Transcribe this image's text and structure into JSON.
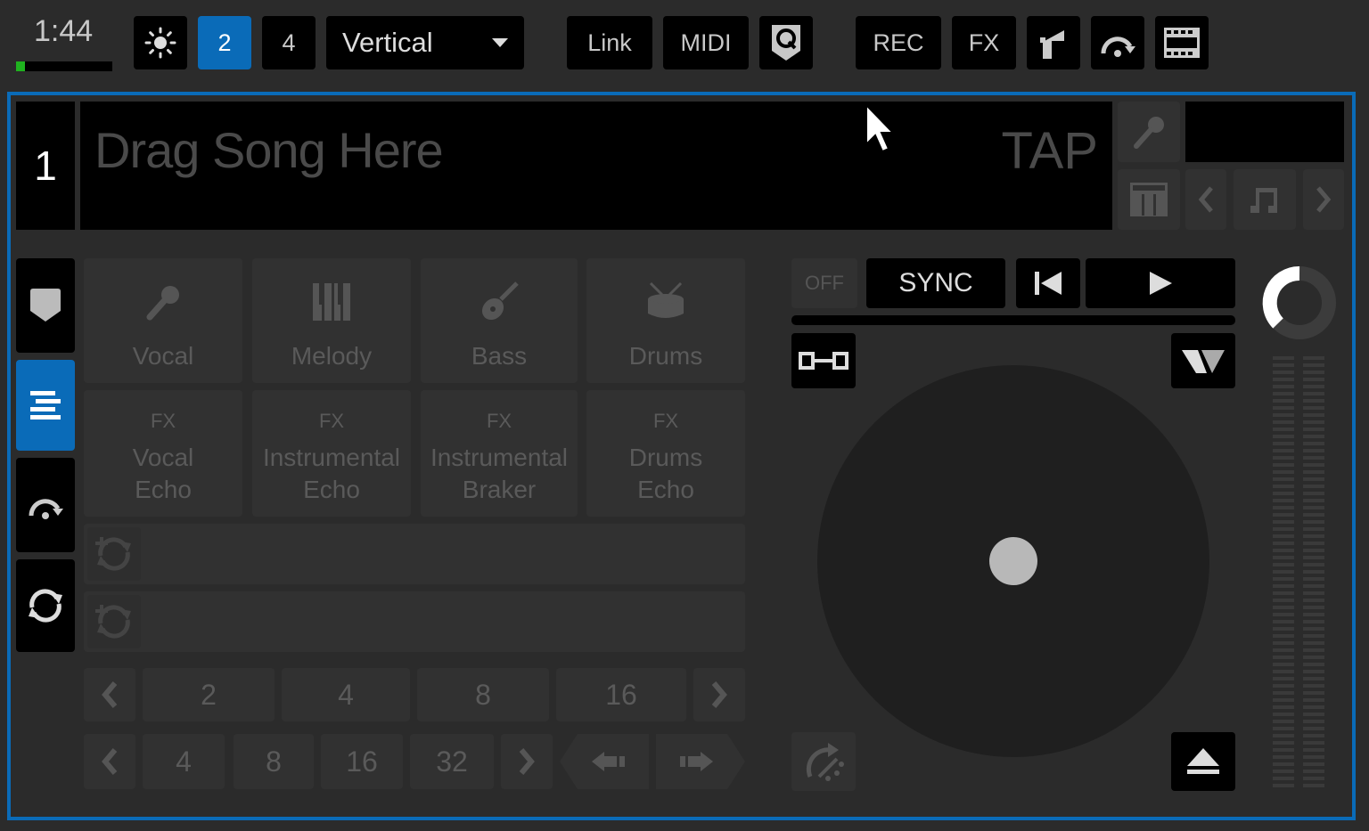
{
  "topbar": {
    "clock": "1:44",
    "level_fraction": 0.09,
    "deck_count_2": "2",
    "deck_count_4": "4",
    "layout_select": "Vertical",
    "link_label": "Link",
    "midi_label": "MIDI",
    "rec_label": "REC",
    "fx_label": "FX"
  },
  "deck": {
    "number": "1",
    "song_placeholder": "Drag Song Here",
    "tap_label": "TAP"
  },
  "stems": {
    "pads": [
      {
        "label": "Vocal",
        "icon": "microphone-icon"
      },
      {
        "label": "Melody",
        "icon": "piano-icon"
      },
      {
        "label": "Bass",
        "icon": "guitar-icon"
      },
      {
        "label": "Drums",
        "icon": "drum-icon"
      }
    ],
    "fx_pads": [
      {
        "tag": "FX",
        "line1": "Vocal",
        "line2": "Echo"
      },
      {
        "tag": "FX",
        "line1": "Instrumental",
        "line2": "Echo"
      },
      {
        "tag": "FX",
        "line1": "Instrumental",
        "line2": "Braker"
      },
      {
        "tag": "FX",
        "line1": "Drums",
        "line2": "Echo"
      }
    ]
  },
  "loops": {
    "row1": [
      "2",
      "4",
      "8",
      "16"
    ],
    "row2": [
      "4",
      "8",
      "16",
      "32"
    ]
  },
  "transport": {
    "off_label": "OFF",
    "sync_label": "SYNC"
  }
}
